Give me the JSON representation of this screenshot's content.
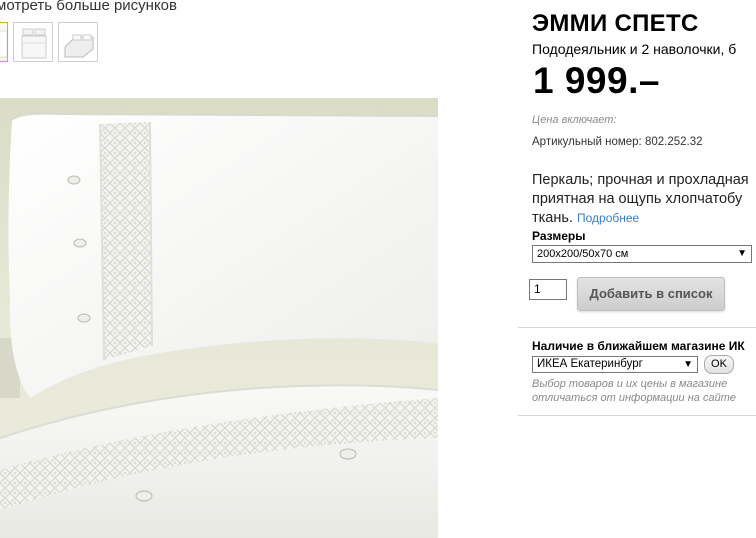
{
  "gallery": {
    "more_pictures_link": "мотреть больше рисунков"
  },
  "product": {
    "name": "ЭММИ СПЕТС",
    "subtitle": "Пододеяльник и 2 наволочки, б",
    "price": "1 999.–",
    "price_includes_label": "Цена включает:",
    "article_label": "Артикульный номер:",
    "article_number": "802.252.32",
    "description_lines": [
      "Перкаль; прочная и прохладная",
      "приятная на ощупь хлопчатобу",
      "ткань."
    ],
    "more_link": "Подробнее"
  },
  "sizes": {
    "label": "Размеры",
    "selected": "200x200/50x70 см"
  },
  "cart": {
    "quantity": "1",
    "add_button": "Добавить в список"
  },
  "store": {
    "label": "Наличие в ближайшем магазине ИК",
    "selected": "ИКЕА Екатеринбург",
    "ok_button": "OK",
    "note_lines": [
      "Выбор товаров и их цены в магазине",
      "отличаться от информации на сайте"
    ]
  }
}
